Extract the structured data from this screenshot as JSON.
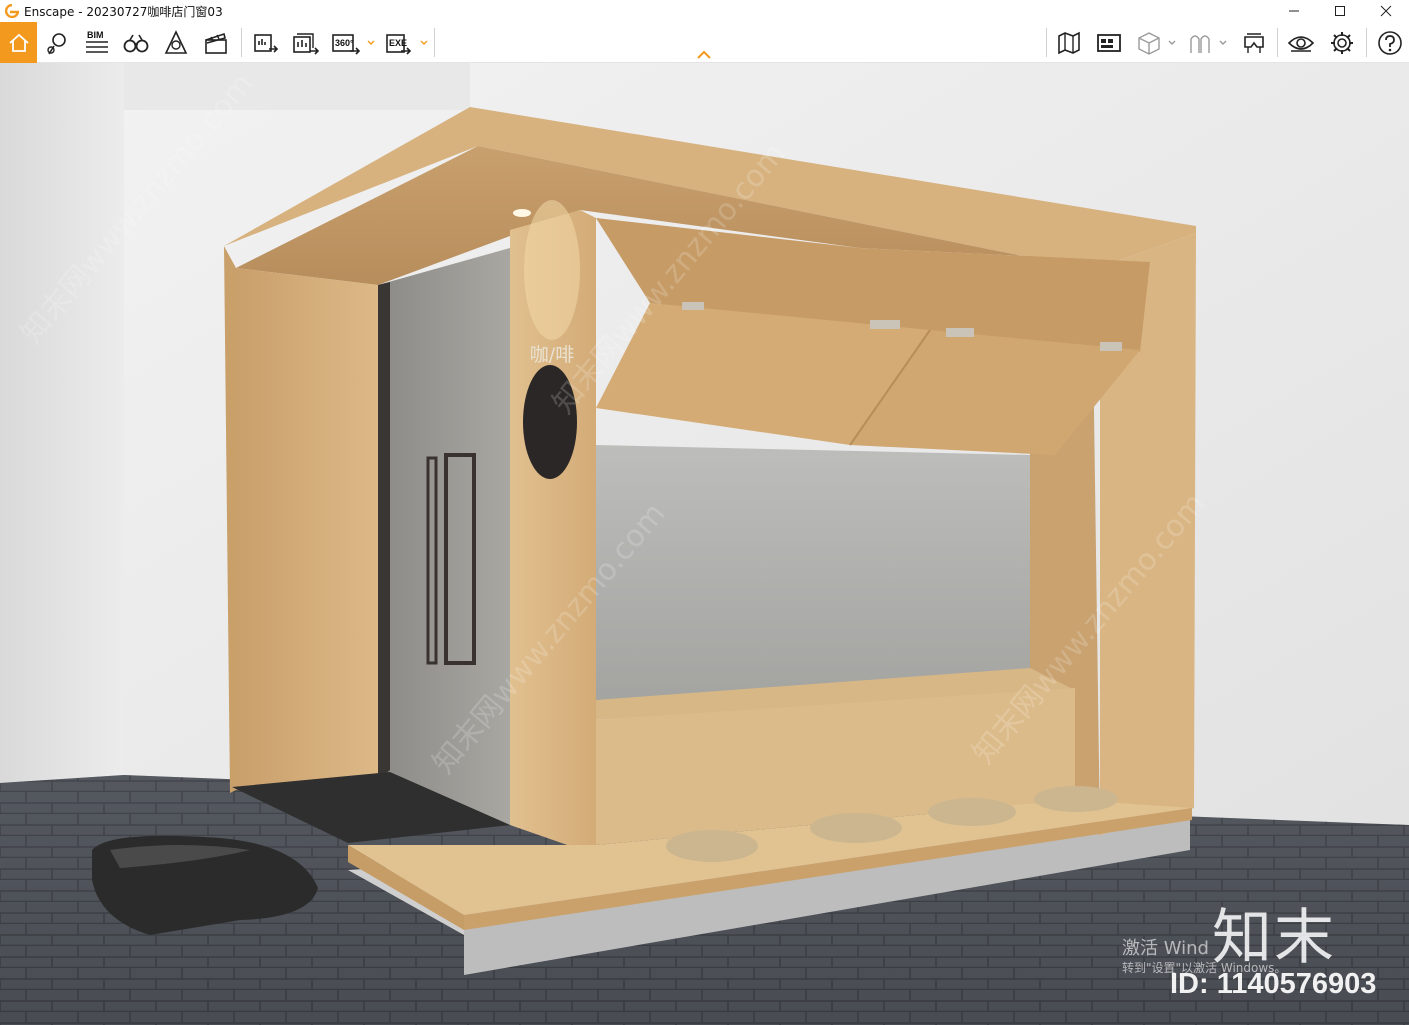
{
  "window": {
    "title": "Enscape - 20230727咖啡店门窗03",
    "controls": [
      "minimize",
      "maximize",
      "close"
    ]
  },
  "toolbar": {
    "left_tools": [
      {
        "icon": "home-icon"
      },
      {
        "icon": "map-pin-icon"
      },
      {
        "icon": "bim-icon",
        "label": "BIM"
      },
      {
        "icon": "binoculars-icon"
      },
      {
        "icon": "bell-cone-icon"
      },
      {
        "icon": "clapperboard-icon"
      },
      {
        "icon": "batch-render-icon"
      },
      {
        "icon": "render-panorama-icon"
      },
      {
        "icon": "export-360-icon",
        "label": "360°"
      },
      {
        "icon": "export-exe-icon",
        "label": "EXE"
      }
    ],
    "right_tools": [
      {
        "icon": "map-view-icon"
      },
      {
        "icon": "asset-library-icon"
      },
      {
        "icon": "cube-icon"
      },
      {
        "icon": "people-icon"
      },
      {
        "icon": "vr-headset-icon"
      },
      {
        "icon": "visual-settings-icon"
      },
      {
        "icon": "gear-icon"
      },
      {
        "icon": "help-icon"
      }
    ]
  },
  "viewport": {
    "sign_text": "咖/啡",
    "watermark_site": "知末网www.znzmo.com",
    "brand_mark": "知末",
    "activate_line1": "激活 Wind",
    "activate_line2": "转到\"设置\"以激活 Windows。",
    "image_id": "ID: 1140576903"
  },
  "colors": {
    "accent": "#f39a1e",
    "wood": "#d7b07c",
    "wall": "#e4e4e4",
    "paving": "#4e5259"
  }
}
